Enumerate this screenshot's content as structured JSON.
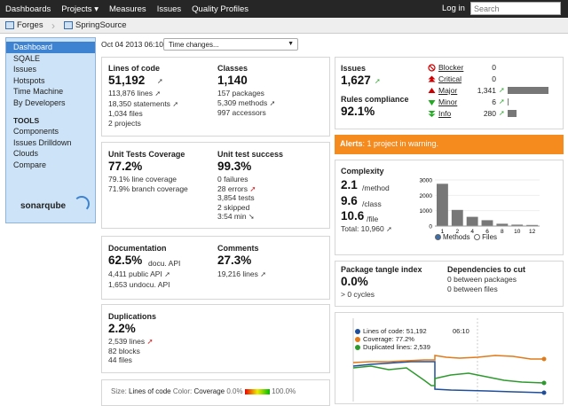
{
  "topbar": {
    "nav": [
      "Dashboards",
      "Projects ▾",
      "Measures",
      "Issues",
      "Quality Profiles"
    ],
    "login": "Log in",
    "search_placeholder": "Search"
  },
  "breadcrumb": {
    "items": [
      "Forges",
      "SpringSource"
    ]
  },
  "sidebar": {
    "items": [
      "Dashboard",
      "SQALE",
      "Issues",
      "Hotspots",
      "Time Machine",
      "By Developers"
    ],
    "tools_heading": "TOOLS",
    "tools": [
      "Components",
      "Issues Drilldown",
      "Clouds",
      "Compare"
    ],
    "logo": "sonarqube"
  },
  "date": "Oct 04 2013 06:10",
  "time_changes": "Time changes...",
  "size": {
    "loc_label": "Lines of code",
    "loc": "51,192",
    "loc_details": [
      "113,876 lines",
      "18,350 statements",
      "1,034 files",
      "2 projects"
    ],
    "classes_label": "Classes",
    "classes": "1,140",
    "classes_details": [
      "157 packages",
      "5,309 methods",
      "997 accessors"
    ]
  },
  "tests": {
    "cov_label": "Unit Tests Coverage",
    "cov": "77.2%",
    "cov_details": [
      "79.1% line coverage",
      "71.9% branch coverage"
    ],
    "succ_label": "Unit test success",
    "succ": "99.3%",
    "succ_details": [
      "0 failures",
      "28 errors",
      "3,854 tests",
      "2 skipped",
      "3:54 min"
    ]
  },
  "doc": {
    "doc_label": "Documentation",
    "doc": "62.5%",
    "doc_suffix": "docu. API",
    "doc_details": [
      "4,411 public API",
      "1,653 undocu. API"
    ],
    "com_label": "Comments",
    "com": "27.3%",
    "com_details": [
      "19,216 lines"
    ]
  },
  "dup": {
    "label": "Duplications",
    "value": "2.2%",
    "details": [
      "2,539 lines",
      "82 blocks",
      "44 files"
    ]
  },
  "treemap_bar": {
    "size_prefix": "Size:",
    "size_metric": "Lines of code",
    "color_prefix": "Color:",
    "color_metric": "Coverage",
    "min": "0.0%",
    "max": "100.0%"
  },
  "issues": {
    "label": "Issues",
    "value": "1,627",
    "compliance_label": "Rules compliance",
    "compliance": "92.1%",
    "severities": [
      {
        "name": "Blocker",
        "count": "0",
        "frac": 0
      },
      {
        "name": "Critical",
        "count": "0",
        "frac": 0
      },
      {
        "name": "Major",
        "count": "1,341",
        "frac": 1.0
      },
      {
        "name": "Minor",
        "count": "6",
        "frac": 0.01
      },
      {
        "name": "Info",
        "count": "280",
        "frac": 0.21
      }
    ]
  },
  "alert": {
    "prefix": "Alerts",
    "text": ": 1 project in warning."
  },
  "complexity": {
    "label": "Complexity",
    "method": "2.1",
    "method_unit": "/method",
    "class": "9.6",
    "class_unit": "/class",
    "file": "10.6",
    "file_unit": "/file",
    "total": "Total: 10,960",
    "toggle": [
      "Methods",
      "Files"
    ]
  },
  "chart_data": {
    "type": "bar",
    "categories": [
      "1",
      "2",
      "4",
      "6",
      "8",
      "10",
      "12"
    ],
    "values": [
      2750,
      1050,
      600,
      380,
      150,
      90,
      70
    ],
    "ylim": [
      0,
      3000
    ],
    "yticks": [
      "0",
      "1000",
      "2000",
      "3000"
    ]
  },
  "tangle": {
    "label": "Package tangle index",
    "value": "0.0%",
    "cycles": "> 0 cycles",
    "deps_label": "Dependencies to cut",
    "deps": [
      "0 between packages",
      "0 between files"
    ]
  },
  "timeline": {
    "time": "06:10",
    "legend": [
      {
        "name": "Lines of code: 51,192",
        "color": "#1f4e9a"
      },
      {
        "name": "Coverage: 77.2%",
        "color": "#e07a1a"
      },
      {
        "name": "Duplicated lines: 2,539",
        "color": "#2e9a2e"
      }
    ]
  }
}
